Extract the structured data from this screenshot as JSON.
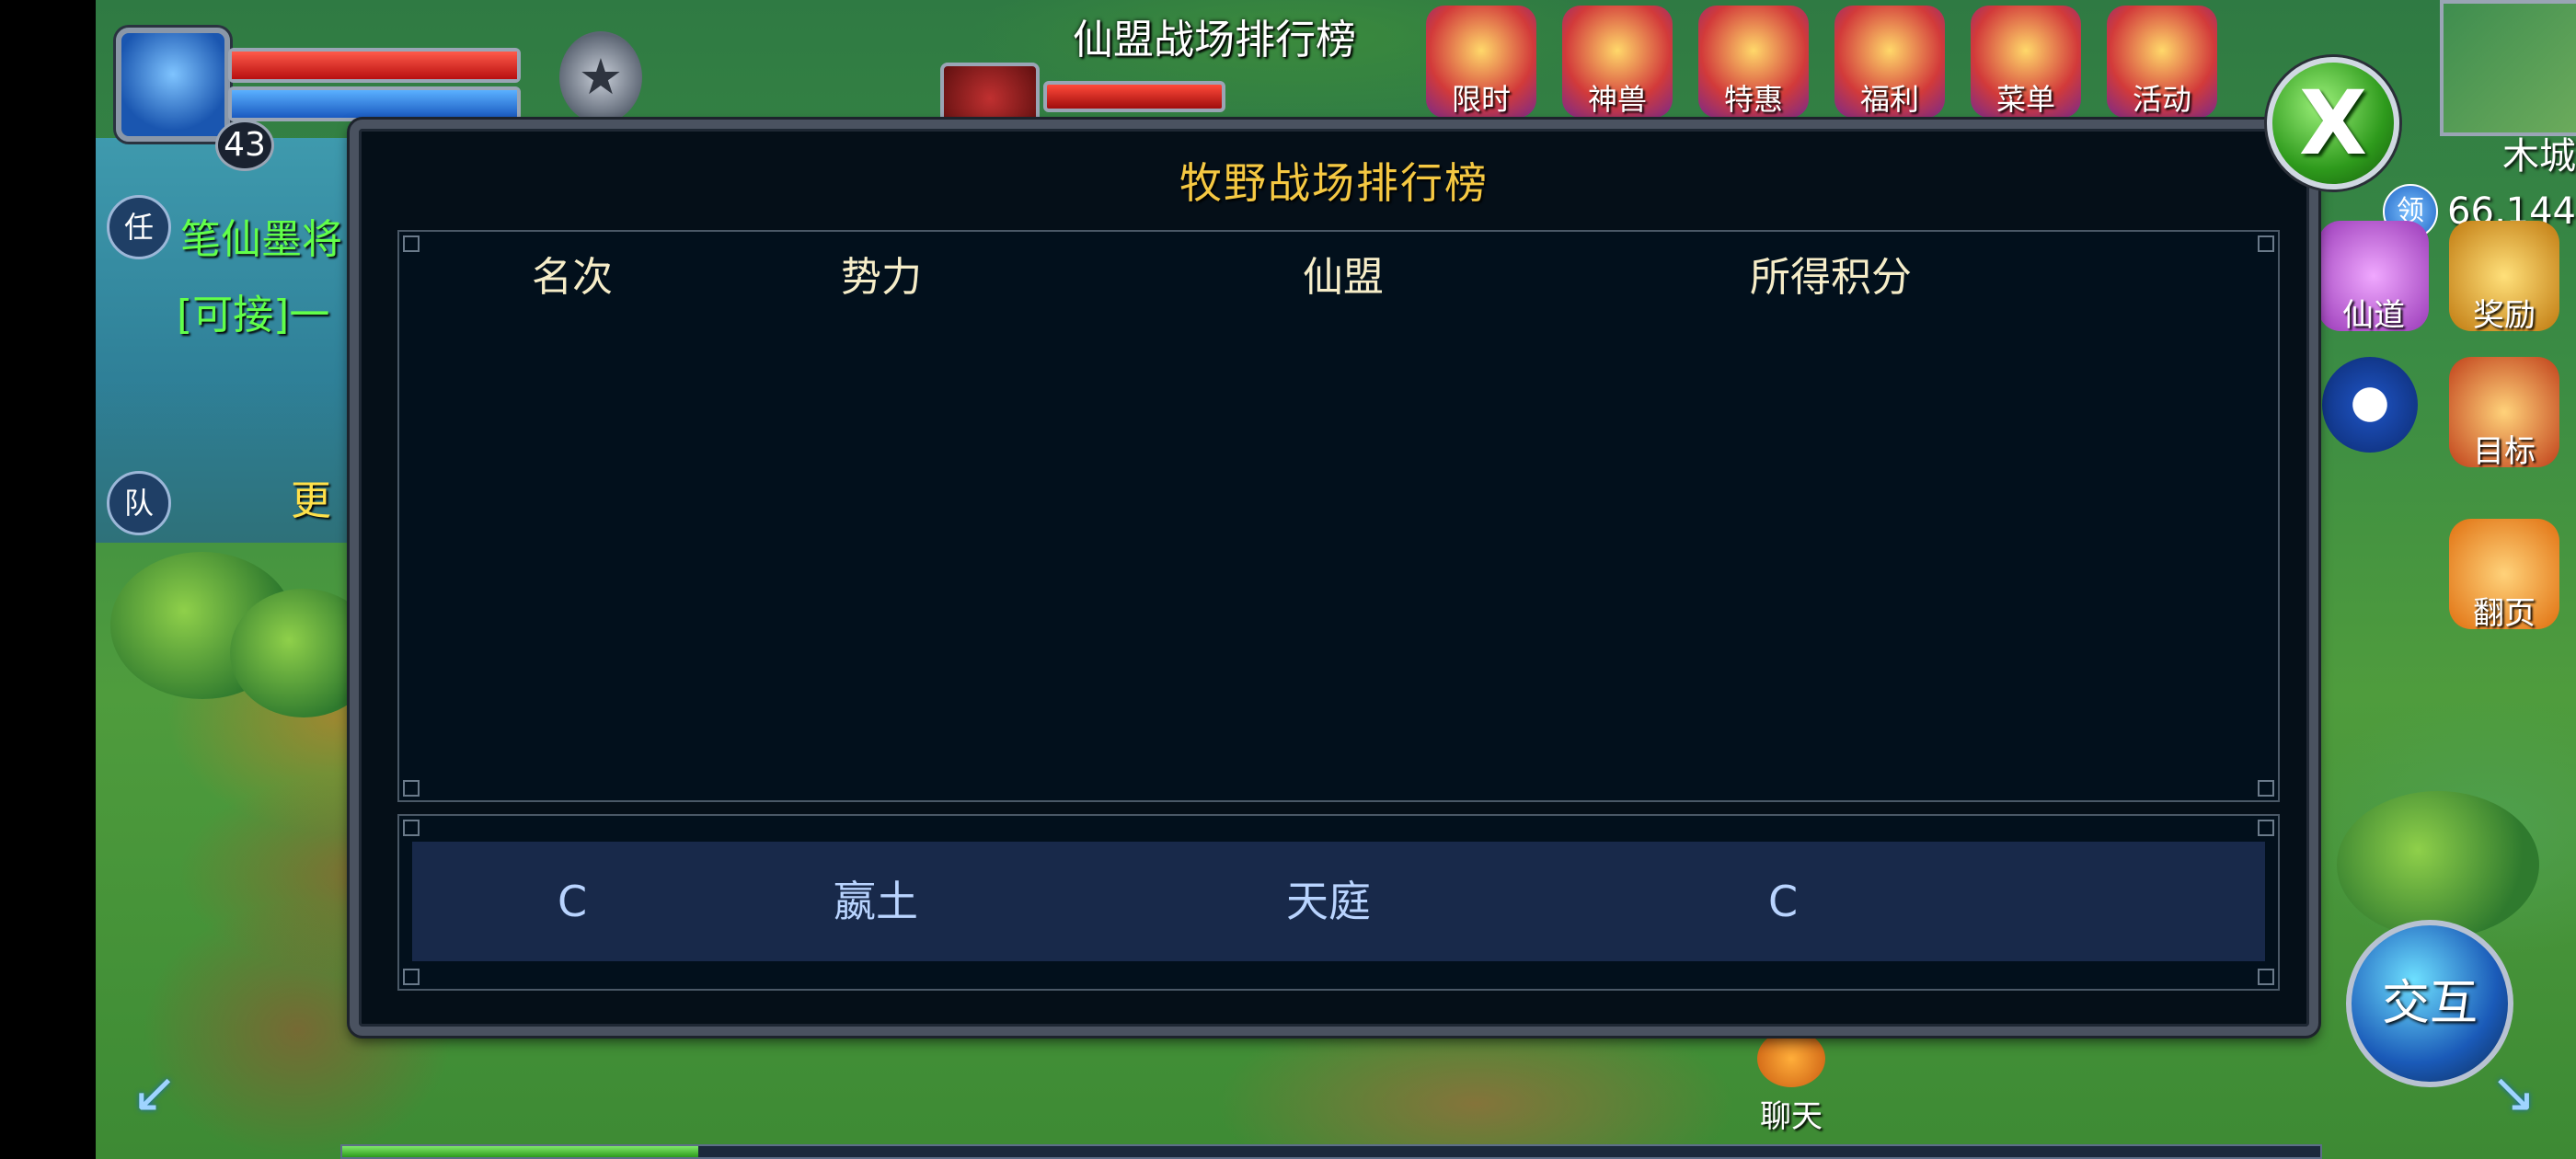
{
  "player": {
    "level": "43",
    "hp_fraction": 1.0,
    "mp_fraction": 1.0
  },
  "target": {
    "hp_fraction": 1.0
  },
  "map_title": "仙盟战场排行榜",
  "activity_icons": [
    {
      "label": "限时",
      "icon": "treasure-icon"
    },
    {
      "label": "神兽",
      "icon": "beast-icon"
    },
    {
      "label": "特惠",
      "icon": "gift-icon"
    },
    {
      "label": "福利",
      "icon": "red-envelope-icon"
    },
    {
      "label": "菜单",
      "icon": "menu-icon"
    },
    {
      "label": "活动",
      "icon": "event-icon"
    }
  ],
  "location": {
    "coords": "木城66,144",
    "claim_badge": "领"
  },
  "side_menu": {
    "immortal_path": "仙道",
    "reward": "奖励",
    "target": "目标",
    "flip_page": "翻页"
  },
  "quest_tracker": {
    "task_tab": "任",
    "team_tab": "队",
    "task_title": "笔仙墨将",
    "task_subtitle": "[可接]一",
    "more": "更"
  },
  "ranking_panel": {
    "title": "牧野战场排行榜",
    "columns": [
      "名次",
      "势力",
      "仙盟",
      "所得积分"
    ],
    "rows": [],
    "self_row": {
      "rank": "C",
      "faction": "嬴土",
      "alliance": "天庭",
      "score": "C"
    }
  },
  "bottom_bar": {
    "chat_label": "聊天",
    "interact_label": "交互",
    "xp_fraction": 0.18
  },
  "colors": {
    "panel_title": "#f5c842",
    "column_header": "#f6edc8",
    "self_row_bg": "#18294a",
    "self_row_text": "#b9d4ff",
    "quest_text": "#62ff4a"
  }
}
